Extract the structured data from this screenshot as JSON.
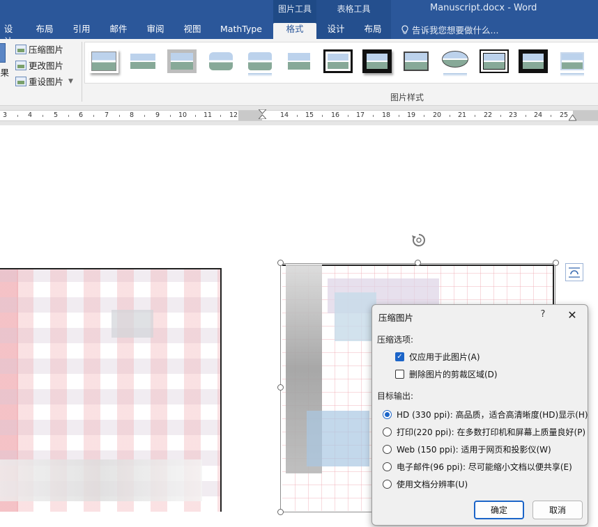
{
  "app": {
    "doc_title": "Manuscript.docx - Word",
    "context_groups": {
      "picture_tools": "图片工具",
      "table_tools": "表格工具"
    },
    "tabs": [
      {
        "id": "design",
        "label": "设计"
      },
      {
        "id": "layout",
        "label": "布局"
      },
      {
        "id": "references",
        "label": "引用"
      },
      {
        "id": "mailings",
        "label": "邮件"
      },
      {
        "id": "review",
        "label": "审阅"
      },
      {
        "id": "view",
        "label": "视图"
      },
      {
        "id": "mathtype",
        "label": "MathType"
      },
      {
        "id": "format",
        "label": "格式",
        "active": true
      },
      {
        "id": "table-design",
        "label": "设计"
      },
      {
        "id": "table-layout",
        "label": "布局"
      }
    ],
    "tell_me": "告诉我您想要做什么..."
  },
  "ribbon": {
    "effects_label": "效果",
    "compress_picture": "压缩图片",
    "change_picture": "更改图片",
    "reset_picture": "重设图片",
    "styles_group_label": "图片样式",
    "gallery_styles": [
      "simple-frame-white",
      "soft-edge",
      "simple-frame-grey",
      "rounded-frame",
      "reflected-rounded",
      "soft-edge-rect",
      "thick-black-frame",
      "black-shadow-rect",
      "thin-black-frame",
      "oval-reflected",
      "double-frame-black",
      "thick-matte-black",
      "reflected-bevel"
    ]
  },
  "ruler": {
    "numbers": [
      "3",
      "4",
      "5",
      "6",
      "7",
      "8",
      "9",
      "10",
      "11",
      "12",
      "14",
      "15",
      "16",
      "17",
      "18",
      "19",
      "20",
      "21",
      "22",
      "23",
      "24",
      "25"
    ]
  },
  "dialog": {
    "title": "压缩图片",
    "help": "?",
    "close": "✕",
    "compress_options_label": "压缩选项:",
    "apply_only_this": "仅应用于此图片(A)",
    "apply_only_this_checked": true,
    "delete_cropped": "删除图片的剪裁区域(D)",
    "delete_cropped_checked": false,
    "target_output_label": "目标输出:",
    "resolutions": [
      {
        "label": "HD (330 ppi): 高品质，适合高清晰度(HD)显示(H)",
        "selected": true
      },
      {
        "label": "打印(220 ppi): 在多数打印机和屏幕上质量良好(P)",
        "selected": false
      },
      {
        "label": "Web (150 ppi): 适用于网页和投影仪(W)",
        "selected": false
      },
      {
        "label": "电子邮件(96 ppi): 尽可能缩小文档以便共享(E)",
        "selected": false
      },
      {
        "label": "使用文档分辨率(U)",
        "selected": false
      }
    ],
    "ok": "确定",
    "cancel": "取消"
  },
  "colors": {
    "word_blue": "#2b579a",
    "accent": "#1b64c8"
  }
}
